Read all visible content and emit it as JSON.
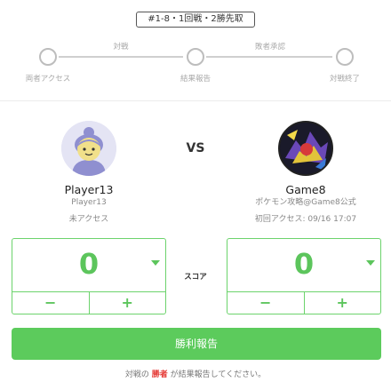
{
  "match": {
    "tag": "#1-8・1回戦・2勝先取"
  },
  "progress": {
    "segments": [
      "対戦",
      "敗者承認"
    ],
    "nodes": [
      "両者アクセス",
      "結果報告",
      "対戦終了"
    ]
  },
  "players": {
    "left": {
      "name": "Player13",
      "sub": "Player13",
      "access": "未アクセス",
      "avatar_icon": "default-user-avatar-icon"
    },
    "right": {
      "name": "Game8",
      "sub": "ポケモン攻略@Game8公式",
      "access": "初回アクセス: 09/16 17:07",
      "avatar_icon": "game8-pokemon-avatar-icon"
    }
  },
  "vs_label": "VS",
  "score": {
    "label": "スコア",
    "left_value": "0",
    "right_value": "0",
    "minus": "−",
    "plus": "+"
  },
  "actions": {
    "report_label": "勝利報告"
  },
  "note": {
    "before": "対戦の ",
    "winner": "勝者",
    "after": " が結果報告してください。"
  },
  "colors": {
    "accent": "#5ccb5c",
    "winner": "#e53935",
    "inactive": "#bdbdbd"
  }
}
